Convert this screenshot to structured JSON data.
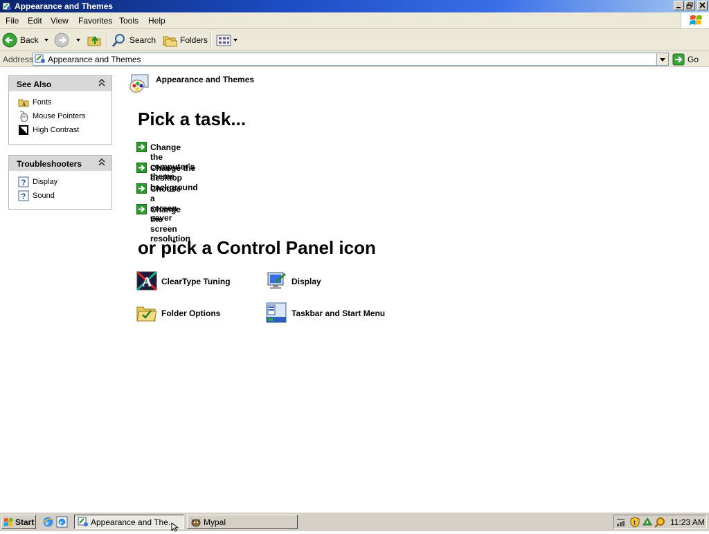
{
  "window": {
    "title": "Appearance and Themes"
  },
  "menu": [
    "File",
    "Edit",
    "View",
    "Favorites",
    "Tools",
    "Help"
  ],
  "toolbar": {
    "back_label": "Back",
    "search_label": "Search",
    "folders_label": "Folders"
  },
  "address": {
    "label": "Address",
    "value": "Appearance and Themes",
    "go_label": "Go"
  },
  "see_also": {
    "title": "See Also",
    "items": [
      "Fonts",
      "Mouse Pointers",
      "High Contrast"
    ]
  },
  "troubleshooters": {
    "title": "Troubleshooters",
    "items": [
      "Display",
      "Sound"
    ]
  },
  "content": {
    "category_title": "Appearance and Themes",
    "pick_task_heading": "Pick a task...",
    "tasks": [
      "Change the computer's theme",
      "Change the desktop background",
      "Choose a screen saver",
      "Change the screen resolution"
    ],
    "pick_icon_heading": "or pick a Control Panel icon",
    "icons": [
      "ClearType Tuning",
      "Display",
      "Folder Options",
      "Taskbar and Start Menu"
    ]
  },
  "taskbar": {
    "start_label": "Start",
    "windows": [
      "Appearance and The...",
      "Mypal"
    ],
    "clock": "11:23 AM"
  }
}
